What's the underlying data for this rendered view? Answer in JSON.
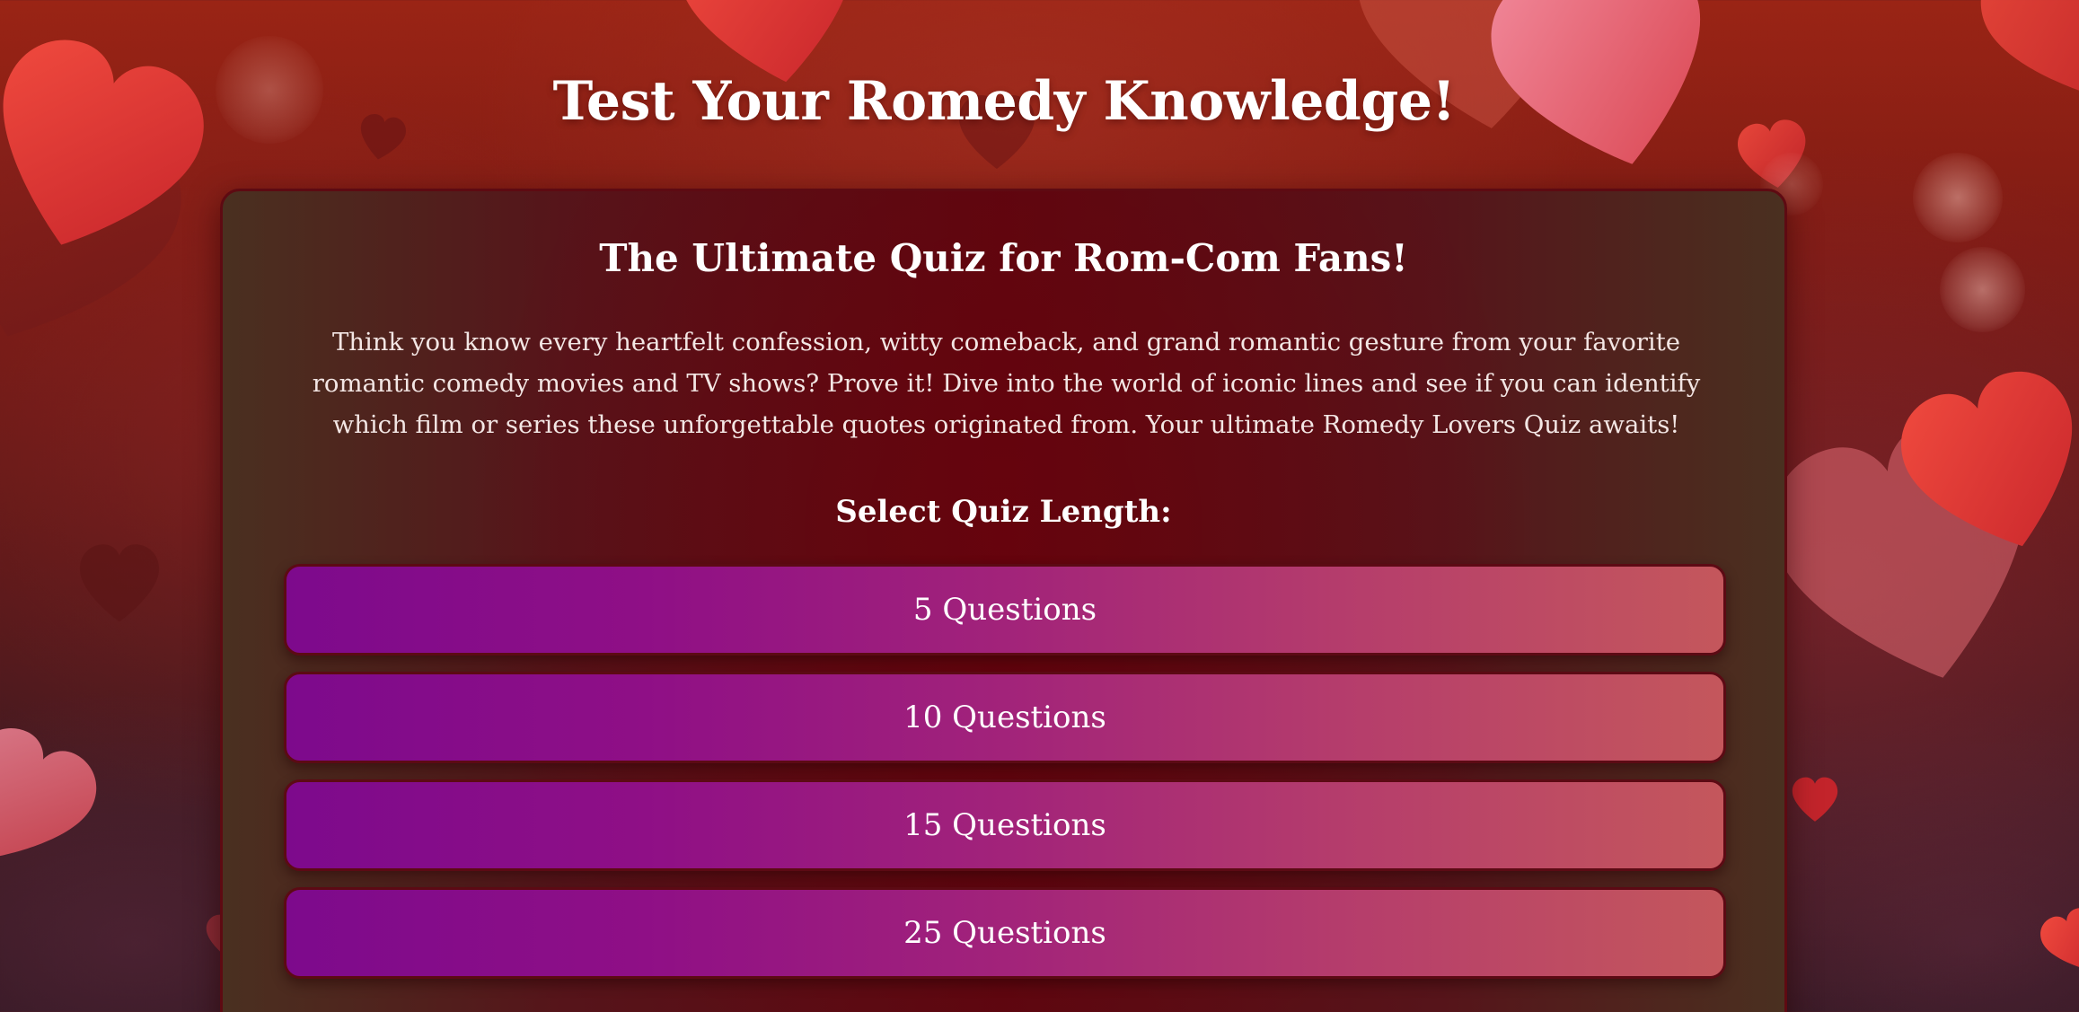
{
  "page": {
    "title": "Test Your Romedy Knowledge!"
  },
  "quiz_card": {
    "heading": "The Ultimate Quiz for Rom-Com Fans!",
    "intro": "Think you know every heartfelt confession, witty comeback, and grand romantic gesture from your favorite romantic comedy movies and TV shows? Prove it! Dive into the world of iconic lines and see if you can identify which film or series these unforgettable quotes originated from. Your ultimate Romedy Lovers Quiz awaits!",
    "length_label": "Select Quiz Length:",
    "options": [
      {
        "label": "5 Questions"
      },
      {
        "label": "10 Questions"
      },
      {
        "label": "15 Questions"
      },
      {
        "label": "25 Questions"
      }
    ]
  },
  "colors": {
    "background_top": "#9a2415",
    "background_bottom": "#2e1620",
    "card_center": "#5c0710",
    "card_border": "#5e0a12",
    "button_gradient_start": "#7d0a8c",
    "button_gradient_end": "#c4575c",
    "heart_red": "#e53a3a",
    "heart_pink": "#ec6e8a"
  },
  "decorations": {
    "background_icon": "heart-icon"
  }
}
